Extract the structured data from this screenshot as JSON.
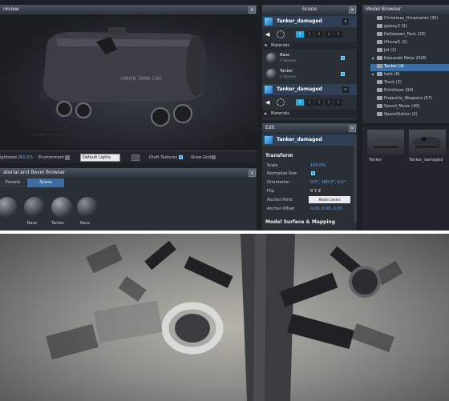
{
  "preview": {
    "title": "review",
    "shininess_label": "ightness",
    "shininess_value": "261.0%",
    "environment_label": "Environment",
    "lights_select": "Default Lights",
    "draft_textures_label": "Draft Textures",
    "show_grid_label": "Show Grid",
    "truck_text": "UNION TANK CAR"
  },
  "scene": {
    "title": "Scene",
    "objects": [
      {
        "name": "Tanker_damaged",
        "tabs": [
          "1",
          "2",
          "3",
          "4",
          "5"
        ]
      },
      {
        "name": "Tanker_damaged",
        "tabs": [
          "1",
          "2",
          "3",
          "4",
          "5"
        ]
      }
    ],
    "materials_header": "Materials",
    "materials": [
      {
        "name": "Base",
        "detail": "3 Textures"
      },
      {
        "name": "Tanker",
        "detail": "3 Textures"
      }
    ]
  },
  "edit": {
    "title": "Edit",
    "object_name": "Tanker_damaged",
    "transform_header": "Transform",
    "rows": [
      {
        "label": "Scale",
        "value": "100.0%"
      },
      {
        "label": "Normalize Size",
        "value": ""
      },
      {
        "label": "Orientation",
        "value": "0.0°, 180.0°, 0.0°"
      },
      {
        "label": "Flip",
        "value": "X  Y  Z"
      },
      {
        "label": "Anchor Point",
        "value": "Model Center"
      },
      {
        "label": "Anchor Offset",
        "value": "0.00, 0.00, 0.00"
      }
    ],
    "surface_header": "Model Surface & Mapping"
  },
  "model_browser": {
    "title": "Model Browser",
    "items": [
      {
        "label": "Christmas_Ornaments (35)",
        "expander": false,
        "selected": false
      },
      {
        "label": "galaxy3 (3)",
        "expander": false,
        "selected": false
      },
      {
        "label": "Halloween_Pack (29)",
        "expander": false,
        "selected": false
      },
      {
        "label": "iPhone5 (2)",
        "expander": false,
        "selected": false
      },
      {
        "label": "Jet (2)",
        "expander": false,
        "selected": false
      },
      {
        "label": "Kawasaki Ninja 250R",
        "expander": true,
        "selected": false
      },
      {
        "label": "Tanker (4)",
        "expander": false,
        "selected": true
      },
      {
        "label": "tank (8)",
        "expander": true,
        "selected": false
      },
      {
        "label": "Truck (2)",
        "expander": false,
        "selected": false
      },
      {
        "label": "Primitives (94)",
        "expander": false,
        "selected": false
      },
      {
        "label": "Projectile_Weapons (57)",
        "expander": false,
        "selected": false
      },
      {
        "label": "Sound_Music (40)",
        "expander": false,
        "selected": false
      },
      {
        "label": "SpaceStation (2)",
        "expander": false,
        "selected": false
      }
    ],
    "thumbs": [
      "Tanker",
      "Tanker_damaged"
    ]
  },
  "material_browser": {
    "title": "aterial and Bevel Browser",
    "tabs": [
      "Presets",
      "Scene"
    ],
    "swatches": [
      "",
      "Base",
      "Tanker",
      "Base"
    ]
  },
  "colors": {
    "accent_blue": "#29a8e0",
    "value_blue": "#5fb1ff",
    "panel_bg": "#2a2e35",
    "selection": "#3a6ea5"
  }
}
